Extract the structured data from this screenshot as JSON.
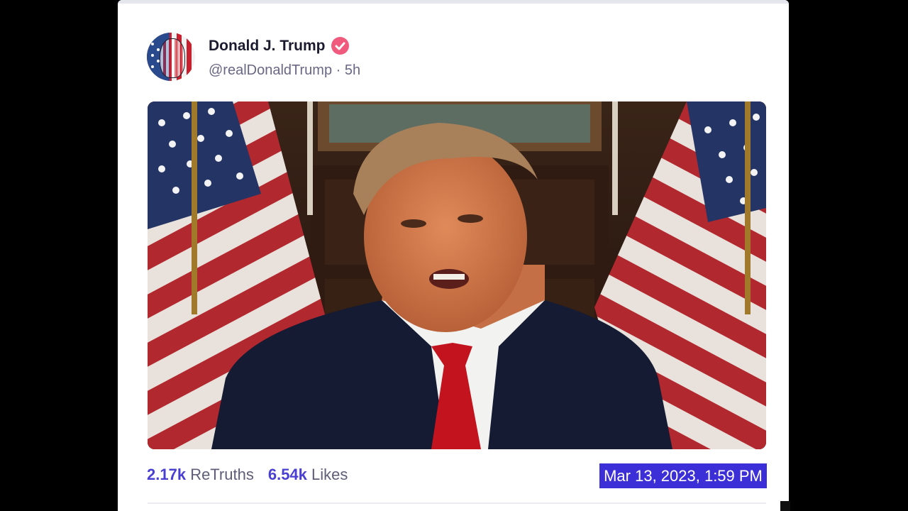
{
  "post": {
    "author": {
      "display_name": "Donald J. Trump",
      "handle": "@realDonaldTrump",
      "time_ago": "5h",
      "separator": "·",
      "verified_icon": "verified-badge-icon",
      "verified_color": "#f05a7c"
    },
    "media": {
      "type": "video-thumbnail"
    },
    "stats": {
      "retruths_count": "2.17k",
      "retruths_label": "ReTruths",
      "likes_count": "6.54k",
      "likes_label": "Likes"
    },
    "timestamp": "Mar 13, 2023, 1:59 PM",
    "colors": {
      "accent": "#4a3fd3",
      "selection_highlight": "#3d2fd8",
      "text_primary": "#1b1a2e",
      "text_secondary": "#696783"
    }
  }
}
